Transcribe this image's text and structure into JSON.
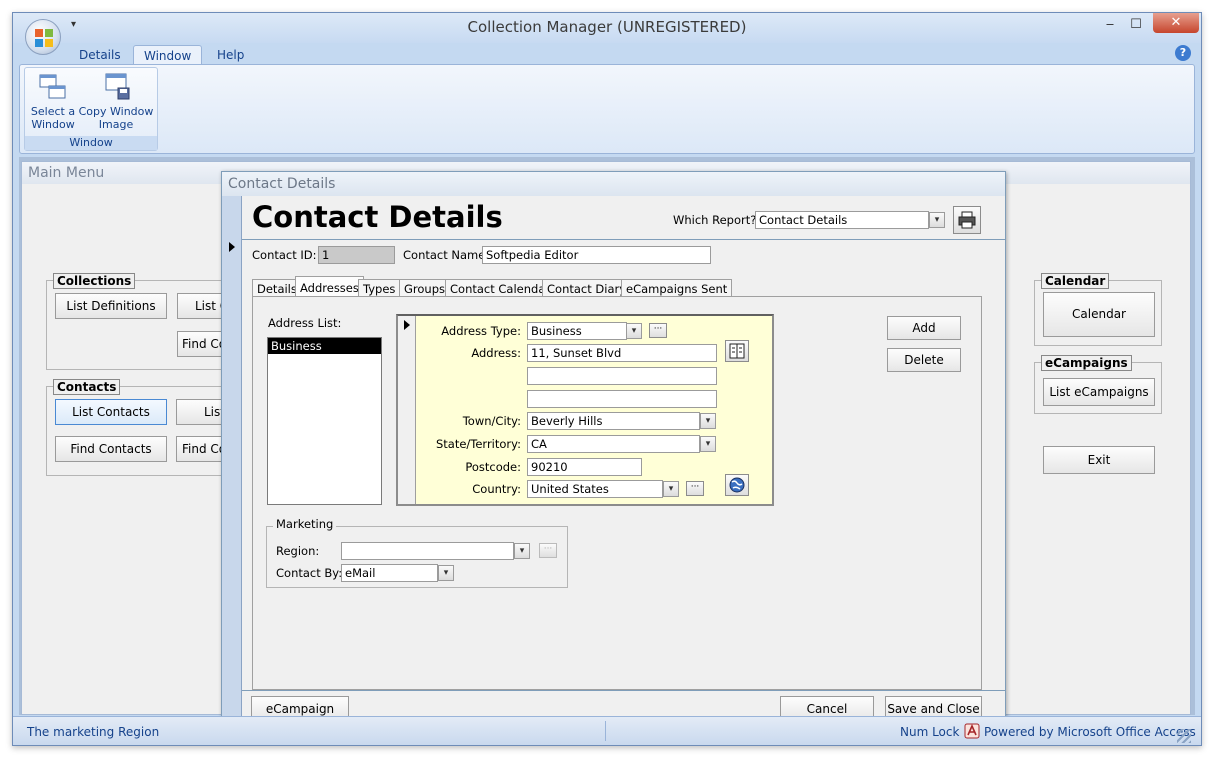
{
  "window": {
    "title": "Collection Manager (UNREGISTERED)",
    "minimize": "‒",
    "maximize": "☐",
    "close": "✕",
    "qat_glyph": "▾",
    "help_glyph": "?"
  },
  "ribbon": {
    "tabs": [
      "Details",
      "Window",
      "Help"
    ],
    "active_tab": "Window",
    "group_label": "Window",
    "buttons": [
      {
        "line1": "Select a",
        "line2": "Window"
      },
      {
        "line1": "Copy Window",
        "line2": "Image"
      }
    ]
  },
  "main_menu": {
    "title": "Main Menu",
    "collections": {
      "label": "Collections",
      "list_definitions": "List Definitions",
      "list_collections_partial": "List C",
      "find_collections_partial": "Find Col"
    },
    "contacts": {
      "label": "Contacts",
      "list_contacts": "List Contacts",
      "find_contacts": "Find Contacts",
      "list_partial": "List",
      "find_partial": "Find Co"
    },
    "calendar": {
      "label": "Calendar",
      "button": "Calendar"
    },
    "ecampaigns": {
      "label": "eCampaigns",
      "button": "List eCampaigns"
    },
    "exit": "Exit"
  },
  "dialog": {
    "title_bar": "Contact Details",
    "heading": "Contact Details",
    "which_report_label": "Which Report?",
    "which_report_value": "Contact Details",
    "contact_id_label": "Contact ID:",
    "contact_id_value": "1",
    "contact_name_label": "Contact Name:",
    "contact_name_value": "Softpedia Editor",
    "tabs": [
      "Details",
      "Addresses",
      "Types",
      "Groups",
      "Contact Calendar",
      "Contact Diary",
      "eCampaigns Sent"
    ],
    "active_tab": "Addresses",
    "address_list_label": "Address List:",
    "address_list_items": [
      "Business"
    ],
    "address": {
      "type_label": "Address Type:",
      "type_value": "Business",
      "address_label": "Address:",
      "line1": "11, Sunset Blvd",
      "line2": "",
      "line3": "",
      "town_label": "Town/City:",
      "town_value": "Beverly Hills",
      "state_label": "State/Territory:",
      "state_value": "CA",
      "postcode_label": "Postcode:",
      "postcode_value": "90210",
      "country_label": "Country:",
      "country_value": "United States"
    },
    "add_button": "Add",
    "delete_button": "Delete",
    "marketing": {
      "label": "Marketing",
      "region_label": "Region:",
      "region_value": "",
      "contact_by_label": "Contact By:",
      "contact_by_value": "eMail"
    },
    "ecampaign_button": "eCampaign",
    "cancel_button": "Cancel",
    "save_close_button": "Save and Close",
    "ellipsis": "···",
    "dropdown_glyph": "▾"
  },
  "status": {
    "message": "The marketing Region",
    "num_lock": "Num Lock",
    "powered_by": "Powered by Microsoft Office Access"
  },
  "colors": {
    "accent": "#15428b",
    "subform_bg": "#ffffd7",
    "selection": "#000000"
  }
}
